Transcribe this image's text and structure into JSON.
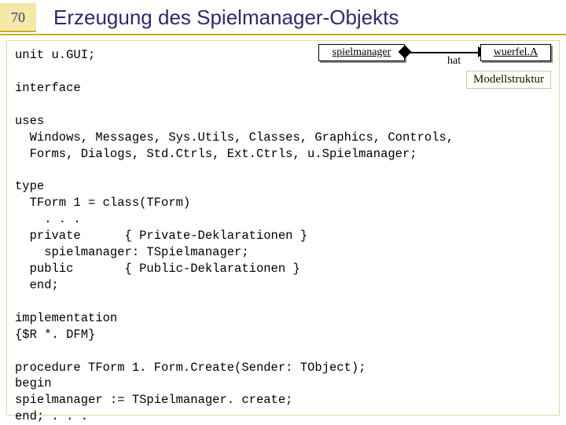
{
  "header": {
    "page_number": "70",
    "title": "Erzeugung des Spielmanager-Objekts"
  },
  "diagram": {
    "left_box": "spielmanager",
    "right_box": "wuerfel.A",
    "relation": "hat",
    "caption": "Modellstruktur"
  },
  "code": {
    "line1": "unit u.GUI;",
    "line2": "",
    "line3": "interface",
    "line4": "",
    "line5": "uses",
    "line6": "  Windows, Messages, Sys.Utils, Classes, Graphics, Controls,",
    "line7": "  Forms, Dialogs, Std.Ctrls, Ext.Ctrls, u.Spielmanager;",
    "line8": "",
    "line9": "type",
    "line10": "  TForm 1 = class(TForm)",
    "line11": "    . . .",
    "line12": "  private      { Private-Deklarationen }",
    "line13": "    spielmanager: TSpielmanager;",
    "line14": "  public       { Public-Deklarationen }",
    "line15": "  end;",
    "line16": "",
    "line17": "implementation",
    "line18": "{$R *. DFM}",
    "line19": "",
    "line20": "procedure TForm 1. Form.Create(Sender: TObject);",
    "line21": "begin",
    "line22": "spielmanager := TSpielmanager. create;",
    "line23": "end; . . ."
  }
}
